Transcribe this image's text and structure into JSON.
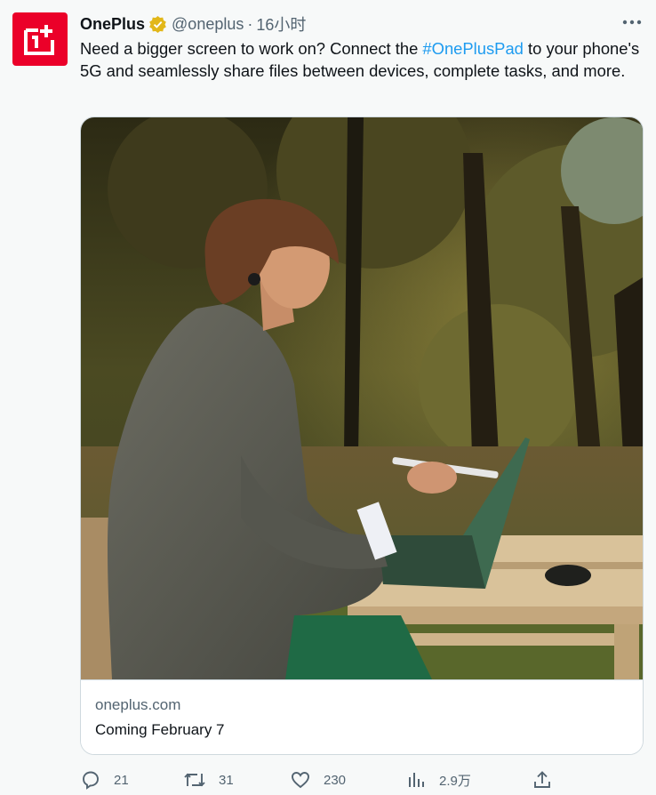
{
  "tweet": {
    "author_name": "OnePlus",
    "author_handle": "@oneplus",
    "separator": "·",
    "time": "16小时",
    "text_before": "Need a bigger screen to work on? Connect the ",
    "hashtag": "#OnePlusPad",
    "text_after": " to your phone's 5G and seamlessly share files between devices, complete tasks, and more."
  },
  "avatar": {
    "brand_color": "#eb0029",
    "icon": "oneplus-logo"
  },
  "card": {
    "domain": "oneplus.com",
    "title": "Coming February 7"
  },
  "actions": {
    "reply_count": "21",
    "retweet_count": "31",
    "like_count": "230",
    "views_count": "2.9万"
  },
  "colors": {
    "link": "#1d9bf0",
    "secondary_text": "#536471",
    "verified_gold": "#e2b719"
  }
}
